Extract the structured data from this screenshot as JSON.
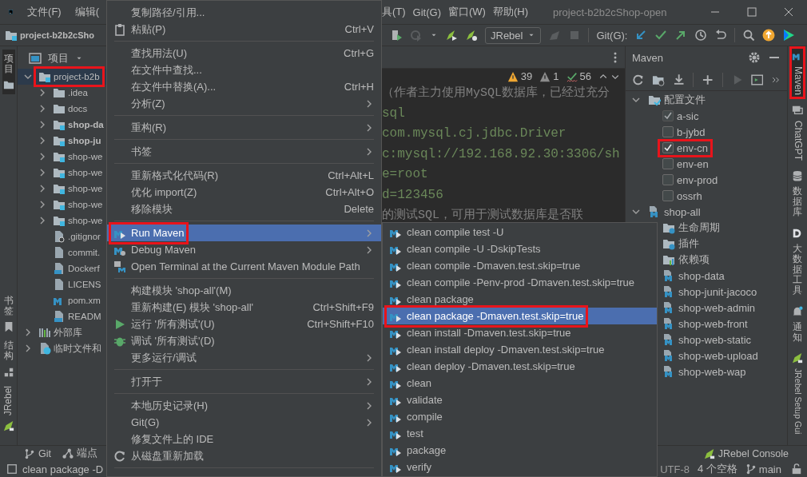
{
  "title_bar": {
    "menus_left": [
      "文件(F)",
      "编辑("
    ],
    "menus_right": [
      "具(T)",
      "Git(G)",
      "窗口(W)",
      "帮助(H)"
    ],
    "title": "project-b2b2cShop-open"
  },
  "toolbar": {
    "project": "project-b2b2cSho",
    "run_config": "JRebel",
    "git_label": "Git(G):"
  },
  "left_stripe": [
    {
      "label": "项目",
      "selected": true
    },
    {
      "label": "书签",
      "selected": false
    },
    {
      "label": "结构",
      "selected": false
    },
    {
      "label": "JRebel",
      "selected": false
    }
  ],
  "project_panel": {
    "title": "项目",
    "tree": [
      {
        "label": "project-b2b",
        "kind": "module",
        "expanded": true,
        "selected": true,
        "annotated": true,
        "emphasized": false,
        "children": [
          {
            "label": ".idea",
            "kind": "folder",
            "expanded": false,
            "selected": false,
            "emphasized": false
          },
          {
            "label": "docs",
            "kind": "folder",
            "expanded": false,
            "selected": false,
            "emphasized": false
          },
          {
            "label": "shop-da",
            "kind": "module",
            "expanded": false,
            "selected": false,
            "emphasized": true
          },
          {
            "label": "shop-ju",
            "kind": "module",
            "expanded": false,
            "selected": false,
            "emphasized": true
          },
          {
            "label": "shop-we",
            "kind": "module",
            "expanded": false,
            "selected": false,
            "emphasized": false
          },
          {
            "label": "shop-we",
            "kind": "module",
            "expanded": false,
            "selected": false,
            "emphasized": false
          },
          {
            "label": "shop-we",
            "kind": "module",
            "expanded": false,
            "selected": false,
            "emphasized": false
          },
          {
            "label": "shop-we",
            "kind": "module",
            "expanded": false,
            "selected": false,
            "emphasized": false
          },
          {
            "label": "shop-we",
            "kind": "module",
            "expanded": false,
            "selected": false,
            "emphasized": false
          },
          {
            "label": ".gitignor",
            "kind": "gitignore",
            "selected": false,
            "emphasized": false
          },
          {
            "label": "commit.",
            "kind": "file",
            "selected": false,
            "emphasized": false
          },
          {
            "label": "Dockerf",
            "kind": "docker",
            "selected": false,
            "emphasized": false
          },
          {
            "label": "LICENS",
            "kind": "file",
            "selected": false,
            "emphasized": false
          },
          {
            "label": "pom.xm",
            "kind": "maven",
            "selected": false,
            "emphasized": false
          },
          {
            "label": "READM",
            "kind": "markdown",
            "selected": false,
            "emphasized": false
          }
        ]
      },
      {
        "label": "外部库",
        "kind": "libraries",
        "expanded": false,
        "selected": false,
        "emphasized": false
      },
      {
        "label": "临时文件和",
        "kind": "scratches",
        "expanded": false,
        "selected": false,
        "emphasized": false
      }
    ]
  },
  "editor": {
    "inspections": {
      "warnings": "39",
      "weak_warnings": "1",
      "typos": "56"
    },
    "lines": [
      {
        "kind": "comment",
        "text": "（作者主力使用MySQL数据库，已经过充分"
      },
      {
        "kind": "code",
        "text": "sql"
      },
      {
        "kind": "code",
        "text": "com.mysql.cj.jdbc.Driver"
      },
      {
        "kind": "code",
        "text": "c:mysql://192.168.92.30:3306/sh"
      },
      {
        "kind": "code",
        "text": "e=root"
      },
      {
        "kind": "code",
        "text": "d=123456"
      },
      {
        "kind": "comment",
        "text": "的测试SQL，可用于测试数据库是否联"
      }
    ]
  },
  "maven_panel": {
    "title": "Maven",
    "tree": [
      {
        "label": "配置文件",
        "kind": "profiles",
        "expanded": true,
        "children": [
          {
            "label": "a-sic",
            "kind": "profile",
            "checked": true,
            "disabled": true,
            "annotated": false
          },
          {
            "label": "b-jybd",
            "kind": "profile",
            "checked": false,
            "disabled": false,
            "annotated": false
          },
          {
            "label": "env-cn",
            "kind": "profile",
            "checked": true,
            "disabled": false,
            "annotated": true
          },
          {
            "label": "env-en",
            "kind": "profile",
            "checked": false,
            "disabled": false,
            "annotated": false
          },
          {
            "label": "env-prod",
            "kind": "profile",
            "checked": false,
            "disabled": false,
            "annotated": false
          },
          {
            "label": "ossrh",
            "kind": "profile",
            "checked": false,
            "disabled": false,
            "annotated": false
          }
        ]
      },
      {
        "label": "shop-all",
        "kind": "maven-module",
        "expanded": true,
        "children": [
          {
            "label": "生命周期",
            "kind": "lifecycle"
          },
          {
            "label": "插件",
            "kind": "plugins"
          },
          {
            "label": "依赖项",
            "kind": "dependencies"
          },
          {
            "label": "shop-data",
            "kind": "maven-module"
          },
          {
            "label": "shop-junit-jacoco",
            "kind": "maven-module"
          },
          {
            "label": "shop-web-admin",
            "kind": "maven-module"
          },
          {
            "label": "shop-web-front",
            "kind": "maven-module"
          },
          {
            "label": "shop-web-static",
            "kind": "maven-module"
          },
          {
            "label": "shop-web-upload",
            "kind": "maven-module"
          },
          {
            "label": "shop-web-wap",
            "kind": "maven-module"
          }
        ]
      }
    ]
  },
  "right_stripe": [
    {
      "label": "Maven",
      "selected": true,
      "annotated": true
    },
    {
      "label": "ChatGPT",
      "selected": false,
      "annotated": false
    },
    {
      "label": "数据库",
      "selected": false,
      "annotated": false
    },
    {
      "label": "大数据工具",
      "selected": false,
      "annotated": false
    },
    {
      "label": "通知",
      "selected": false,
      "annotated": false
    },
    {
      "label": "JRebel Setup Gui",
      "selected": false,
      "annotated": false
    }
  ],
  "bottom_bar": {
    "left": [
      "Git",
      "端点"
    ],
    "right": [
      "JRebel Console"
    ]
  },
  "status_bar": {
    "message": "clean package -D",
    "encoding": "UTF-8",
    "indent": "4 个空格",
    "branch": "main"
  },
  "context_menu": {
    "items": [
      {
        "kind": "item",
        "label": "复制路径/引用...",
        "submenu": false,
        "selected": false
      },
      {
        "kind": "item",
        "label": "粘贴(P)",
        "shortcut": "Ctrl+V",
        "submenu": false,
        "selected": false
      },
      {
        "kind": "separator"
      },
      {
        "kind": "item",
        "label": "查找用法(U)",
        "shortcut": "Ctrl+G",
        "submenu": false,
        "selected": false
      },
      {
        "kind": "item",
        "label": "在文件中查找...",
        "submenu": false,
        "selected": false
      },
      {
        "kind": "item",
        "label": "在文件中替换(A)...",
        "shortcut": "Ctrl+H",
        "submenu": false,
        "selected": false
      },
      {
        "kind": "item",
        "label": "分析(Z)",
        "submenu": true,
        "selected": false
      },
      {
        "kind": "separator"
      },
      {
        "kind": "item",
        "label": "重构(R)",
        "submenu": true,
        "selected": false
      },
      {
        "kind": "separator"
      },
      {
        "kind": "item",
        "label": "书签",
        "submenu": true,
        "selected": false
      },
      {
        "kind": "separator"
      },
      {
        "kind": "item",
        "label": "重新格式化代码(R)",
        "shortcut": "Ctrl+Alt+L",
        "submenu": false,
        "selected": false
      },
      {
        "kind": "item",
        "label": "优化 import(Z)",
        "shortcut": "Ctrl+Alt+O",
        "submenu": false,
        "selected": false
      },
      {
        "kind": "item",
        "label": "移除模块",
        "shortcut": "Delete",
        "submenu": false,
        "selected": false
      },
      {
        "kind": "separator"
      },
      {
        "kind": "item",
        "label": "Run Maven",
        "submenu": true,
        "selected": true,
        "annotated": true
      },
      {
        "kind": "item",
        "label": "Debug Maven",
        "submenu": true,
        "selected": false
      },
      {
        "kind": "item",
        "label": "Open Terminal at the Current Maven Module Path",
        "submenu": false,
        "selected": false
      },
      {
        "kind": "separator"
      },
      {
        "kind": "item",
        "label": "构建模块 'shop-all'(M)",
        "submenu": false,
        "selected": false
      },
      {
        "kind": "item",
        "label": "重新构建(E) 模块 'shop-all'",
        "shortcut": "Ctrl+Shift+F9",
        "submenu": false,
        "selected": false
      },
      {
        "kind": "item",
        "label": "运行 '所有测试'(U)",
        "shortcut": "Ctrl+Shift+F10",
        "submenu": false,
        "selected": false
      },
      {
        "kind": "item",
        "label": "调试 '所有测试'(D)",
        "submenu": false,
        "selected": false
      },
      {
        "kind": "item",
        "label": "更多运行/调试",
        "submenu": true,
        "selected": false
      },
      {
        "kind": "separator"
      },
      {
        "kind": "item",
        "label": "打开于",
        "submenu": true,
        "selected": false
      },
      {
        "kind": "separator"
      },
      {
        "kind": "item",
        "label": "本地历史记录(H)",
        "submenu": true,
        "selected": false
      },
      {
        "kind": "item",
        "label": "Git(G)",
        "submenu": true,
        "selected": false
      },
      {
        "kind": "item",
        "label": "修复文件上的 IDE",
        "submenu": false,
        "selected": false
      },
      {
        "kind": "item",
        "label": "从磁盘重新加载",
        "submenu": false,
        "selected": false
      },
      {
        "kind": "separator"
      }
    ]
  },
  "submenu": {
    "items": [
      {
        "label": "clean compile test -U",
        "selected": false
      },
      {
        "label": "clean compile -U -DskipTests",
        "selected": false
      },
      {
        "label": "clean compile -Dmaven.test.skip=true",
        "selected": false
      },
      {
        "label": "clean compile -Penv-prod  -Dmaven.test.skip=true",
        "selected": false
      },
      {
        "label": "clean package",
        "selected": false
      },
      {
        "label": "clean package -Dmaven.test.skip=true",
        "selected": true,
        "annotated": true
      },
      {
        "label": "clean install -Dmaven.test.skip=true",
        "selected": false
      },
      {
        "label": "clean install deploy -Dmaven.test.skip=true",
        "selected": false
      },
      {
        "label": "clean deploy -Dmaven.test.skip=true",
        "selected": false
      },
      {
        "label": "clean",
        "selected": false
      },
      {
        "label": "validate",
        "selected": false
      },
      {
        "label": "compile",
        "selected": false
      },
      {
        "label": "test",
        "selected": false
      },
      {
        "label": "package",
        "selected": false
      },
      {
        "label": "verify",
        "selected": false
      }
    ]
  }
}
